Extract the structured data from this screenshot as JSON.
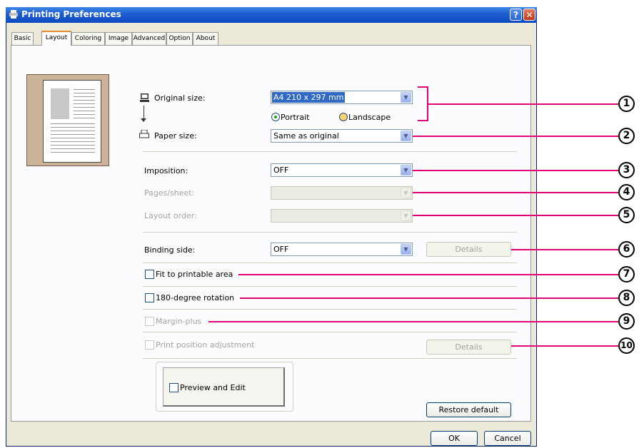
{
  "window": {
    "title": "Printing Preferences"
  },
  "tabs": [
    "Basic",
    "Layout",
    "Coloring",
    "Image",
    "Advanced",
    "Option",
    "About"
  ],
  "active_tab": "Layout",
  "fields": {
    "original_size_label": "Original size:",
    "original_size_value": "A4 210 x 297 mm",
    "orientation_portrait": "Portrait",
    "orientation_landscape": "Landscape",
    "paper_size_label": "Paper size:",
    "paper_size_value": "Same as original",
    "imposition_label": "Imposition:",
    "imposition_value": "OFF",
    "pages_sheet_label": "Pages/sheet:",
    "layout_order_label": "Layout order:",
    "binding_side_label": "Binding side:",
    "binding_side_value": "OFF",
    "details_label": "Details",
    "fit_printable_label": "Fit to printable area",
    "rotation_label": "180-degree rotation",
    "margin_plus_label": "Margin-plus",
    "print_position_label": "Print position adjustment",
    "details2_label": "Details",
    "preview_edit_label": "Preview and Edit",
    "restore_label": "Restore default"
  },
  "footer": {
    "ok": "OK",
    "cancel": "Cancel"
  },
  "callouts": [
    "1",
    "2",
    "3",
    "4",
    "5",
    "6",
    "7",
    "8",
    "9",
    "10"
  ],
  "colors": {
    "accent": "#E2007A",
    "titlebar": "#0A49C0",
    "dialog": "#ECE9D8"
  }
}
